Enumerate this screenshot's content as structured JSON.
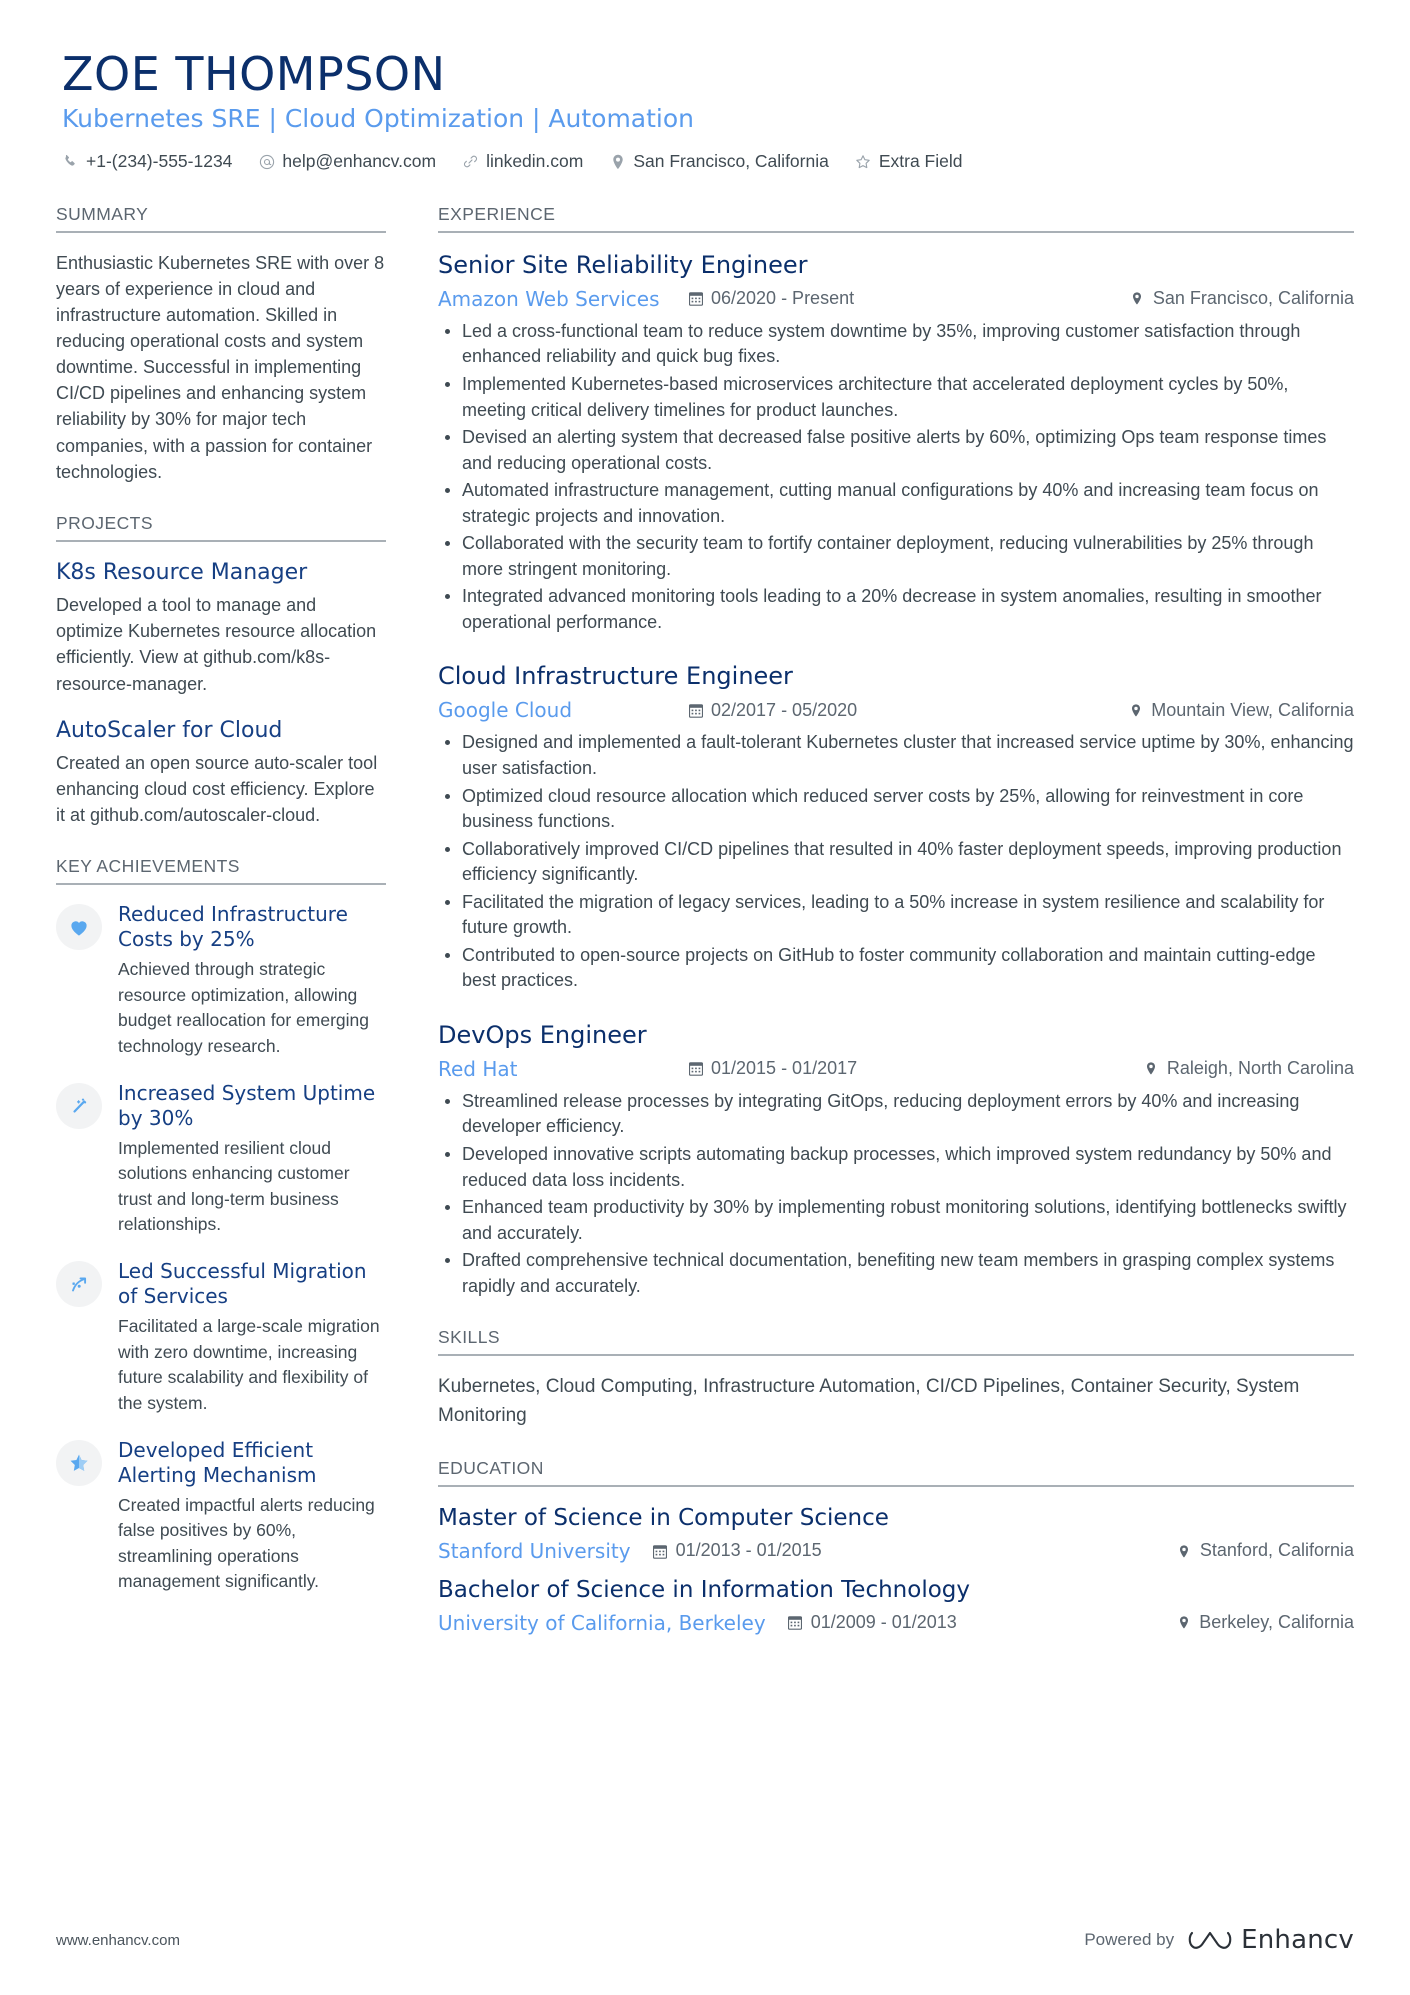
{
  "colors": {
    "name_navy": "#0b2f6b",
    "accent_blue": "#5a9bed",
    "heading_navy": "#163f83",
    "body_gray": "#3f4a52",
    "muted_gray": "#5c6670",
    "rule_gray": "#a9b0b6",
    "badge_bg": "#f2f3f4"
  },
  "header": {
    "name": "ZOE THOMPSON",
    "headline": "Kubernetes SRE | Cloud Optimization | Automation",
    "contacts": [
      {
        "icon": "phone-icon",
        "text": "+1-(234)-555-1234"
      },
      {
        "icon": "email-icon",
        "text": "help@enhancv.com"
      },
      {
        "icon": "link-icon",
        "text": "linkedin.com"
      },
      {
        "icon": "location-pin-icon",
        "text": "San Francisco, California"
      },
      {
        "icon": "star-icon",
        "text": "Extra Field"
      }
    ]
  },
  "left": {
    "summary": {
      "title": "SUMMARY",
      "text": "Enthusiastic Kubernetes SRE with over 8 years of experience in cloud and infrastructure automation. Skilled in reducing operational costs and system downtime. Successful in implementing CI/CD pipelines and enhancing system reliability by 30% for major tech companies, with a passion for container technologies."
    },
    "projects": {
      "title": "PROJECTS",
      "items": [
        {
          "name": "K8s Resource Manager",
          "description": "Developed a tool to manage and optimize Kubernetes resource allocation efficiently. View at github.com/k8s-resource-manager."
        },
        {
          "name": "AutoScaler for Cloud",
          "description": "Created an open source auto-scaler tool enhancing cloud cost efficiency. Explore it at github.com/autoscaler-cloud."
        }
      ]
    },
    "achievements": {
      "title": "KEY ACHIEVEMENTS",
      "items": [
        {
          "icon": "heart-icon",
          "title": "Reduced Infrastructure Costs by 25%",
          "description": "Achieved through strategic resource optimization, allowing budget reallocation for emerging technology research."
        },
        {
          "icon": "magic-wand-icon",
          "title": "Increased System Uptime by 30%",
          "description": "Implemented resilient cloud solutions enhancing customer trust and long-term business relationships."
        },
        {
          "icon": "growth-arrow-icon",
          "title": "Led Successful Migration of Services",
          "description": "Facilitated a large-scale migration with zero downtime, increasing future scalability and flexibility of the system."
        },
        {
          "icon": "star-badge-icon",
          "title": "Developed Efficient Alerting Mechanism",
          "description": "Created impactful alerts reducing false positives by 60%, streamlining operations management significantly."
        }
      ]
    }
  },
  "right": {
    "experience": {
      "title": "EXPERIENCE",
      "jobs": [
        {
          "title": "Senior Site Reliability Engineer",
          "company": "Amazon Web Services",
          "dates": "06/2020 - Present",
          "location": "San Francisco, California",
          "bullets": [
            "Led a cross-functional team to reduce system downtime by 35%, improving customer satisfaction through enhanced reliability and quick bug fixes.",
            "Implemented Kubernetes-based microservices architecture that accelerated deployment cycles by 50%, meeting critical delivery timelines for product launches.",
            "Devised an alerting system that decreased false positive alerts by 60%, optimizing Ops team response times and reducing operational costs.",
            "Automated infrastructure management, cutting manual configurations by 40% and increasing team focus on strategic projects and innovation.",
            "Collaborated with the security team to fortify container deployment, reducing vulnerabilities by 25% through more stringent monitoring.",
            "Integrated advanced monitoring tools leading to a 20% decrease in system anomalies, resulting in smoother operational performance."
          ]
        },
        {
          "title": "Cloud Infrastructure Engineer",
          "company": "Google Cloud",
          "dates": "02/2017 - 05/2020",
          "location": "Mountain View, California",
          "bullets": [
            "Designed and implemented a fault-tolerant Kubernetes cluster that increased service uptime by 30%, enhancing user satisfaction.",
            "Optimized cloud resource allocation which reduced server costs by 25%, allowing for reinvestment in core business functions.",
            "Collaboratively improved CI/CD pipelines that resulted in 40% faster deployment speeds, improving production efficiency significantly.",
            "Facilitated the migration of legacy services, leading to a 50% increase in system resilience and scalability for future growth.",
            "Contributed to open-source projects on GitHub to foster community collaboration and maintain cutting-edge best practices."
          ]
        },
        {
          "title": "DevOps Engineer",
          "company": "Red Hat",
          "dates": "01/2015 - 01/2017",
          "location": "Raleigh, North Carolina",
          "bullets": [
            "Streamlined release processes by integrating GitOps, reducing deployment errors by 40% and increasing developer efficiency.",
            "Developed innovative scripts automating backup processes, which improved system redundancy by 50% and reduced data loss incidents.",
            "Enhanced team productivity by 30% by implementing robust monitoring solutions, identifying bottlenecks swiftly and accurately.",
            "Drafted comprehensive technical documentation, benefiting new team members in grasping complex systems rapidly and accurately."
          ]
        }
      ]
    },
    "skills": {
      "title": "SKILLS",
      "text": "Kubernetes, Cloud Computing, Infrastructure Automation, CI/CD Pipelines, Container Security, System Monitoring"
    },
    "education": {
      "title": "EDUCATION",
      "items": [
        {
          "degree": "Master of Science in Computer Science",
          "school": "Stanford University",
          "dates": "01/2013 - 01/2015",
          "location": "Stanford, California"
        },
        {
          "degree": "Bachelor of Science in Information Technology",
          "school": "University of California, Berkeley",
          "dates": "01/2009 - 01/2013",
          "location": "Berkeley, California"
        }
      ]
    }
  },
  "footer": {
    "site": "www.enhancv.com",
    "powered_by": "Powered by",
    "brand": "Enhancv"
  }
}
